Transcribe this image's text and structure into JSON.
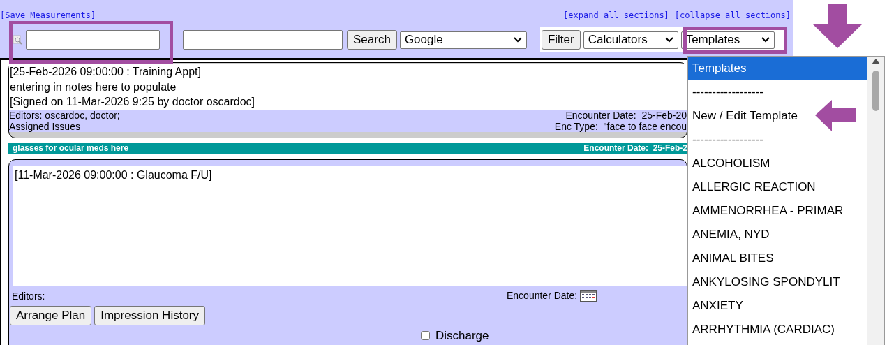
{
  "links": {
    "save": "[Save Measurements]",
    "expand": "[expand all sections]",
    "collapse": "[collapse all sections]"
  },
  "toolbar": {
    "search_button": "Search",
    "engine": "Google",
    "filter_button": "Filter",
    "calculators": "Calculators",
    "templates": "Templates"
  },
  "signed_note": {
    "lines": [
      "[25-Feb-2026 09:00:00 : Training Appt]",
      "entering in notes here to populate",
      "[Signed on 11-Mar-2026 9:25 by doctor oscardoc]"
    ],
    "editors": "Editors: oscardoc, doctor;",
    "issues": "Assigned Issues",
    "encounter_date": "Encounter Date:  25-Feb-20",
    "enc_type": "Enc Type:  \"face to face encou"
  },
  "issue_bar": {
    "title": "glasses for ocular meds here",
    "encounter_date": "Encounter Date:  25-Feb-2"
  },
  "current_note": {
    "text": "[11-Mar-2026 09:00:00 : Glaucoma F/U]",
    "editors": "Editors:",
    "encounter_date_label": "Encounter Date:",
    "buttons": [
      "Arrange Plan",
      "Impression History"
    ],
    "discharge": {
      "label": "Discharge",
      "checked": false
    }
  },
  "template_dropdown": {
    "options": [
      {
        "label": "Templates",
        "selected": true
      },
      {
        "label": "------------------",
        "selected": false
      },
      {
        "label": "New / Edit Template",
        "selected": false
      },
      {
        "label": "------------------",
        "selected": false
      },
      {
        "label": "ALCOHOLISM",
        "selected": false
      },
      {
        "label": "ALLERGIC REACTION",
        "selected": false
      },
      {
        "label": "AMMENORRHEA - PRIMAR",
        "selected": false
      },
      {
        "label": "ANEMIA, NYD",
        "selected": false
      },
      {
        "label": "ANIMAL BITES",
        "selected": false
      },
      {
        "label": "ANKYLOSING SPONDYLIT",
        "selected": false
      },
      {
        "label": "ANXIETY",
        "selected": false
      },
      {
        "label": "ARRHYTHMIA (CARDIAC)",
        "selected": false
      }
    ]
  }
}
